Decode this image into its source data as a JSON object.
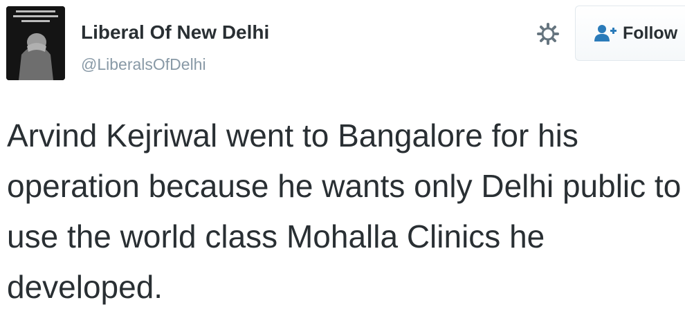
{
  "header": {
    "display_name": "Liberal Of New Delhi",
    "handle": "@LiberalsOfDelhi",
    "settings_icon": "gear-icon",
    "follow": {
      "label": "Follow",
      "icon": "follow-user-icon"
    }
  },
  "avatar": {
    "icon": "profile-photo"
  },
  "tweet": {
    "text": "Arvind Kejriwal went to Bangalore for his operation because he wants only Delhi public to use the world class Mohalla Clinics he developed."
  },
  "colors": {
    "name_text": "#292f33",
    "handle_text": "#8899a6",
    "follow_icon": "#2b7bb9",
    "button_border": "#e1e8ed"
  }
}
